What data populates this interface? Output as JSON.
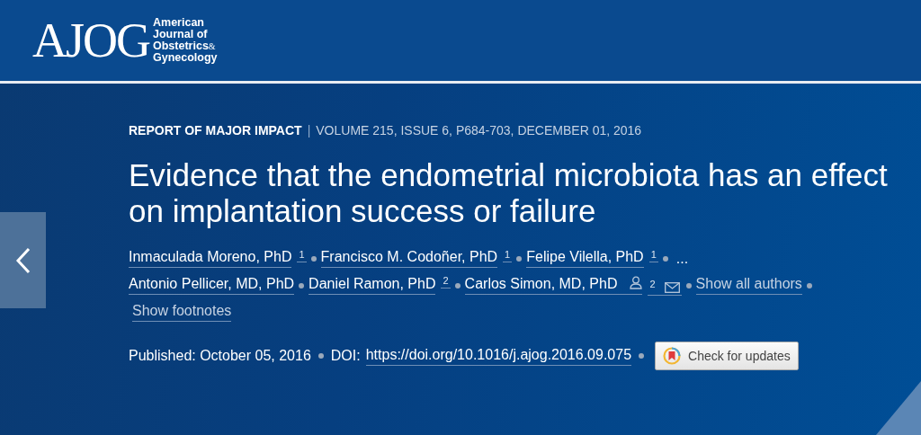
{
  "header": {
    "logo_mark": "AJOG",
    "logo_lines": [
      "American",
      "Journal of",
      "Obstetrics",
      "Gynecology"
    ],
    "logo_amp": "&"
  },
  "article": {
    "type": "REPORT OF MAJOR IMPACT",
    "separator": "|",
    "citation": "VOLUME 215, ISSUE 6, P684-703, DECEMBER 01, 2016",
    "title": "Evidence that the endometrial microbiota has an effect on implantation success or failure",
    "authors_first": [
      {
        "name": "Inmaculada Moreno, PhD",
        "sup": "1",
        "corresponding": false
      },
      {
        "name": "Francisco M. Codoñer, PhD",
        "sup": "1",
        "corresponding": false
      },
      {
        "name": "Felipe Vilella, PhD",
        "sup": "1",
        "corresponding": false
      }
    ],
    "more": "...",
    "authors_second": [
      {
        "name": "Antonio Pellicer, MD, PhD",
        "corresponding": false
      },
      {
        "name": "Daniel Ramon, PhD",
        "sup": "2",
        "corresponding": false
      },
      {
        "name": "Carlos Simon, MD, PhD",
        "sup": "2",
        "corresponding": true
      }
    ],
    "show_all": "Show all authors",
    "show_footnotes": "Show footnotes",
    "published": "Published: October 05, 2016",
    "doi_label": "DOI:",
    "doi": "https://doi.org/10.1016/j.ajog.2016.09.075",
    "updates_button": "Check for updates"
  }
}
